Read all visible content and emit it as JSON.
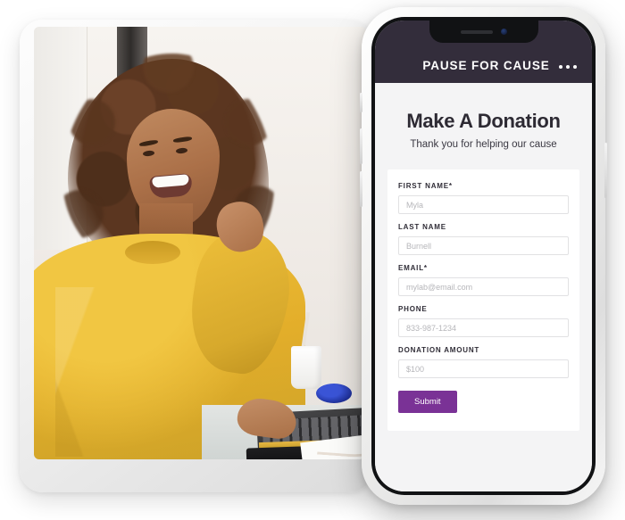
{
  "app": {
    "header": {
      "brand": "PAUSE FOR CAUSE",
      "menu_icon": "kebab-menu-icon"
    },
    "hero": {
      "title": "Make A Donation",
      "subtitle": "Thank you for helping our cause"
    },
    "form": {
      "fields": [
        {
          "label": "FIRST NAME*",
          "placeholder": "Myla",
          "value": ""
        },
        {
          "label": "LAST NAME",
          "placeholder": "Burnell",
          "value": ""
        },
        {
          "label": "EMAIL*",
          "placeholder": "mylab@email.com",
          "value": ""
        },
        {
          "label": "PHONE",
          "placeholder": "833-987-1234",
          "value": ""
        },
        {
          "label": "DONATION AMOUNT",
          "placeholder": "$100",
          "value": ""
        }
      ],
      "submit_label": "Submit"
    }
  },
  "colors": {
    "header_bg": "#332d3b",
    "accent_purple": "#7a3296",
    "screen_bg": "#f4f4f5",
    "card_bg": "#ffffff",
    "input_border": "#e1e1e3",
    "placeholder": "#b6b6ba",
    "sweater_yellow": "#e3ae2a"
  },
  "photo": {
    "alt": "smiling-woman-at-laptop-photo"
  }
}
